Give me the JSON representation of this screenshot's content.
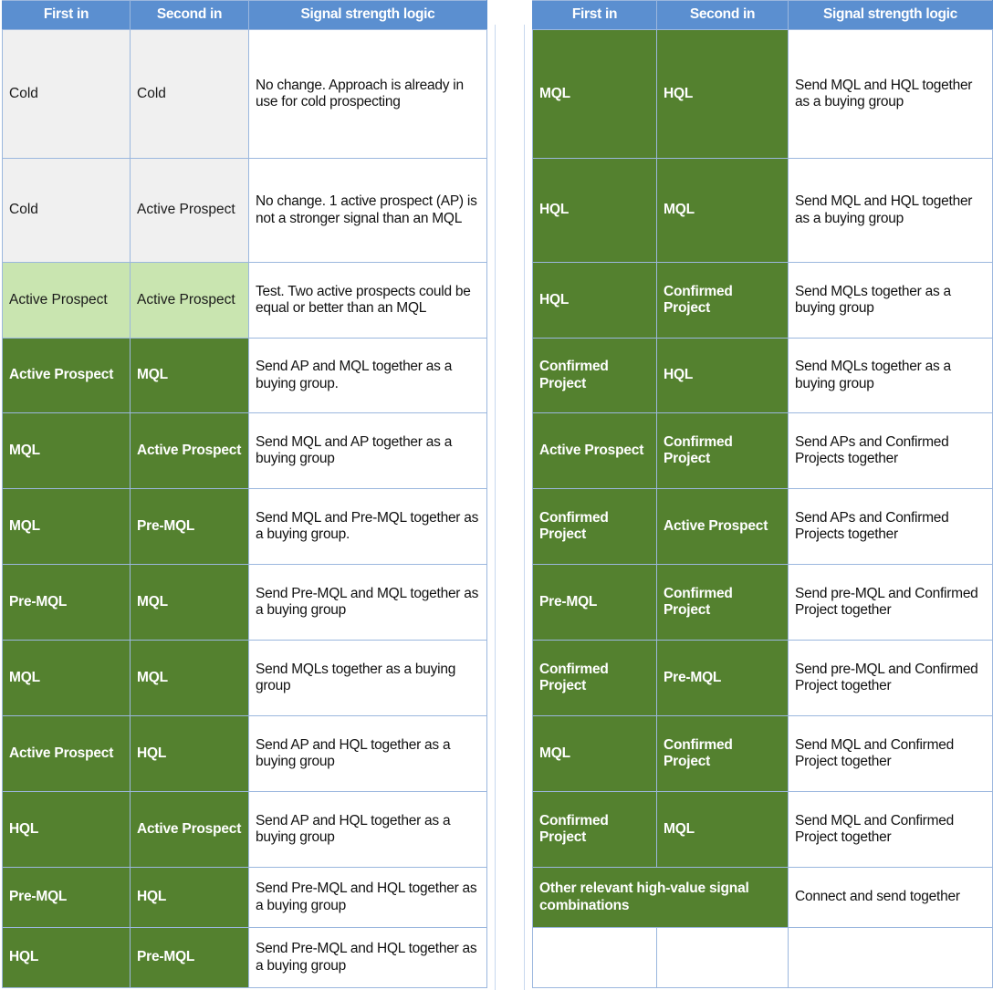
{
  "document": {
    "type": "spreadsheet-table",
    "colors": {
      "header_blue": "#5B8FD0",
      "dark_green": "#54812F",
      "light_green": "#C9E5B0",
      "light_gray": "#F0F0F0",
      "grid_line": "#9BB7DE",
      "header_text": "#FFFFFF"
    }
  },
  "left_table": {
    "headers": {
      "first_in": "First in",
      "second_in": "Second in",
      "logic": "Signal strength logic"
    },
    "rows": [
      {
        "first_in": "Cold",
        "second_in": "Cold",
        "logic": "No change. Approach is already in use for cold prospecting",
        "fill": "gray"
      },
      {
        "first_in": "Cold",
        "second_in": "Active Prospect",
        "logic": "No change. 1 active prospect (AP) is not a stronger signal than an MQL",
        "fill": "gray"
      },
      {
        "first_in": "Active Prospect",
        "second_in": "Active Prospect",
        "logic": "Test. Two active prospects could be equal or better than an MQL",
        "fill": "light"
      },
      {
        "first_in": "Active Prospect",
        "second_in": "MQL",
        "logic": "Send AP and MQL together as a buying group.",
        "fill": "dark"
      },
      {
        "first_in": "MQL",
        "second_in": "Active Prospect",
        "logic": "Send MQL and AP together as a buying group",
        "fill": "dark"
      },
      {
        "first_in": "MQL",
        "second_in": "Pre-MQL",
        "logic": "Send MQL and Pre-MQL together as a buying group.",
        "fill": "dark"
      },
      {
        "first_in": "Pre-MQL",
        "second_in": "MQL",
        "logic": "Send Pre-MQL and MQL together as a buying group",
        "fill": "dark"
      },
      {
        "first_in": "MQL",
        "second_in": "MQL",
        "logic": "Send MQLs together as a buying group",
        "fill": "dark"
      },
      {
        "first_in": "Active Prospect",
        "second_in": "HQL",
        "logic": "Send AP and HQL together as a buying group",
        "fill": "dark"
      },
      {
        "first_in": "HQL",
        "second_in": "Active Prospect",
        "logic": "Send AP and HQL together as a buying group",
        "fill": "dark"
      },
      {
        "first_in": "Pre-MQL",
        "second_in": "HQL",
        "logic": "Send Pre-MQL and HQL together as a buying group",
        "fill": "dark"
      },
      {
        "first_in": "HQL",
        "second_in": "Pre-MQL",
        "logic": "Send Pre-MQL and HQL together as a buying group",
        "fill": "dark"
      }
    ]
  },
  "right_table": {
    "headers": {
      "first_in": "First in",
      "second_in": "Second in",
      "logic": "Signal strength logic"
    },
    "rows": [
      {
        "first_in": "MQL",
        "second_in": "HQL",
        "logic": "Send MQL and HQL together as a buying group",
        "fill": "dark"
      },
      {
        "first_in": "HQL",
        "second_in": "MQL",
        "logic": "Send MQL and HQL together as a buying group",
        "fill": "dark"
      },
      {
        "first_in": "HQL",
        "second_in": "Confirmed Project",
        "logic": "Send MQLs together as a buying group",
        "fill": "dark"
      },
      {
        "first_in": "Confirmed Project",
        "second_in": "HQL",
        "logic": "Send MQLs together as a buying group",
        "fill": "dark"
      },
      {
        "first_in": "Active Prospect",
        "second_in": "Confirmed Project",
        "logic": "Send APs and Confirmed Projects together",
        "fill": "dark"
      },
      {
        "first_in": "Confirmed Project",
        "second_in": "Active Prospect",
        "logic": "Send APs and Confirmed Projects together",
        "fill": "dark"
      },
      {
        "first_in": "Pre-MQL",
        "second_in": "Confirmed Project",
        "logic": "Send pre-MQL and Confirmed Project together",
        "fill": "dark"
      },
      {
        "first_in": "Confirmed Project",
        "second_in": "Pre-MQL",
        "logic": "Send pre-MQL and Confirmed Project together",
        "fill": "dark"
      },
      {
        "first_in": "MQL",
        "second_in": "Confirmed Project",
        "logic": "Send MQL and Confirmed Project together",
        "fill": "dark"
      },
      {
        "first_in": "Confirmed Project",
        "second_in": "MQL",
        "logic": "Send MQL and Confirmed Project together",
        "fill": "dark"
      }
    ],
    "merged_row": {
      "label": "Other relevant high-value signal combinations",
      "logic": "Connect and send together",
      "fill": "dark"
    },
    "empty_row": {
      "first_in": "",
      "second_in": "",
      "logic": ""
    }
  }
}
